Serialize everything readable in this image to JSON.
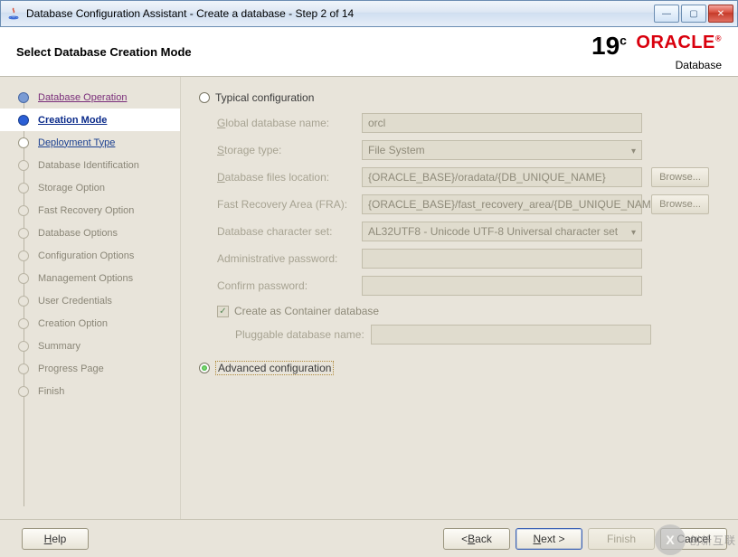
{
  "window": {
    "title": "Database Configuration Assistant - Create a database - Step 2 of 14"
  },
  "header": {
    "page_title": "Select Database Creation Mode",
    "brand_version": "19",
    "brand_version_suffix": "c",
    "brand_name": "ORACLE",
    "brand_sub": "Database"
  },
  "sidebar": {
    "items": [
      {
        "label": "Database Operation",
        "state": "done"
      },
      {
        "label": "Creation Mode",
        "state": "active"
      },
      {
        "label": "Deployment Type",
        "state": "link"
      },
      {
        "label": "Database Identification",
        "state": "pending"
      },
      {
        "label": "Storage Option",
        "state": "pending"
      },
      {
        "label": "Fast Recovery Option",
        "state": "pending"
      },
      {
        "label": "Database Options",
        "state": "pending"
      },
      {
        "label": "Configuration Options",
        "state": "pending"
      },
      {
        "label": "Management Options",
        "state": "pending"
      },
      {
        "label": "User Credentials",
        "state": "pending"
      },
      {
        "label": "Creation Option",
        "state": "pending"
      },
      {
        "label": "Summary",
        "state": "pending"
      },
      {
        "label": "Progress Page",
        "state": "pending"
      },
      {
        "label": "Finish",
        "state": "pending"
      }
    ]
  },
  "content": {
    "typical_label": "Typical configuration",
    "advanced_label": "Advanced configuration",
    "selected_mode": "advanced",
    "labels": {
      "global_db_name": "Global database name:",
      "storage_type": "Storage type:",
      "files_location": "Database files location:",
      "fra": "Fast Recovery Area (FRA):",
      "charset": "Database character set:",
      "admin_pw": "Administrative password:",
      "confirm_pw": "Confirm password:",
      "create_cdb": "Create as Container database",
      "pdb_name": "Pluggable database name:"
    },
    "values": {
      "global_db_name": "orcl",
      "storage_type": "File System",
      "files_location": "{ORACLE_BASE}/oradata/{DB_UNIQUE_NAME}",
      "fra": "{ORACLE_BASE}/fast_recovery_area/{DB_UNIQUE_NAME}",
      "charset": "AL32UTF8 - Unicode UTF-8 Universal character set",
      "admin_pw": "",
      "confirm_pw": "",
      "create_cdb_checked": true,
      "pdb_name": ""
    },
    "browse_label": "Browse..."
  },
  "footer": {
    "help": "Help",
    "back": "< Back",
    "next": "Next >",
    "finish": "Finish",
    "cancel": "Cancel"
  },
  "watermark": {
    "badge": "X",
    "text": "创新互联"
  }
}
